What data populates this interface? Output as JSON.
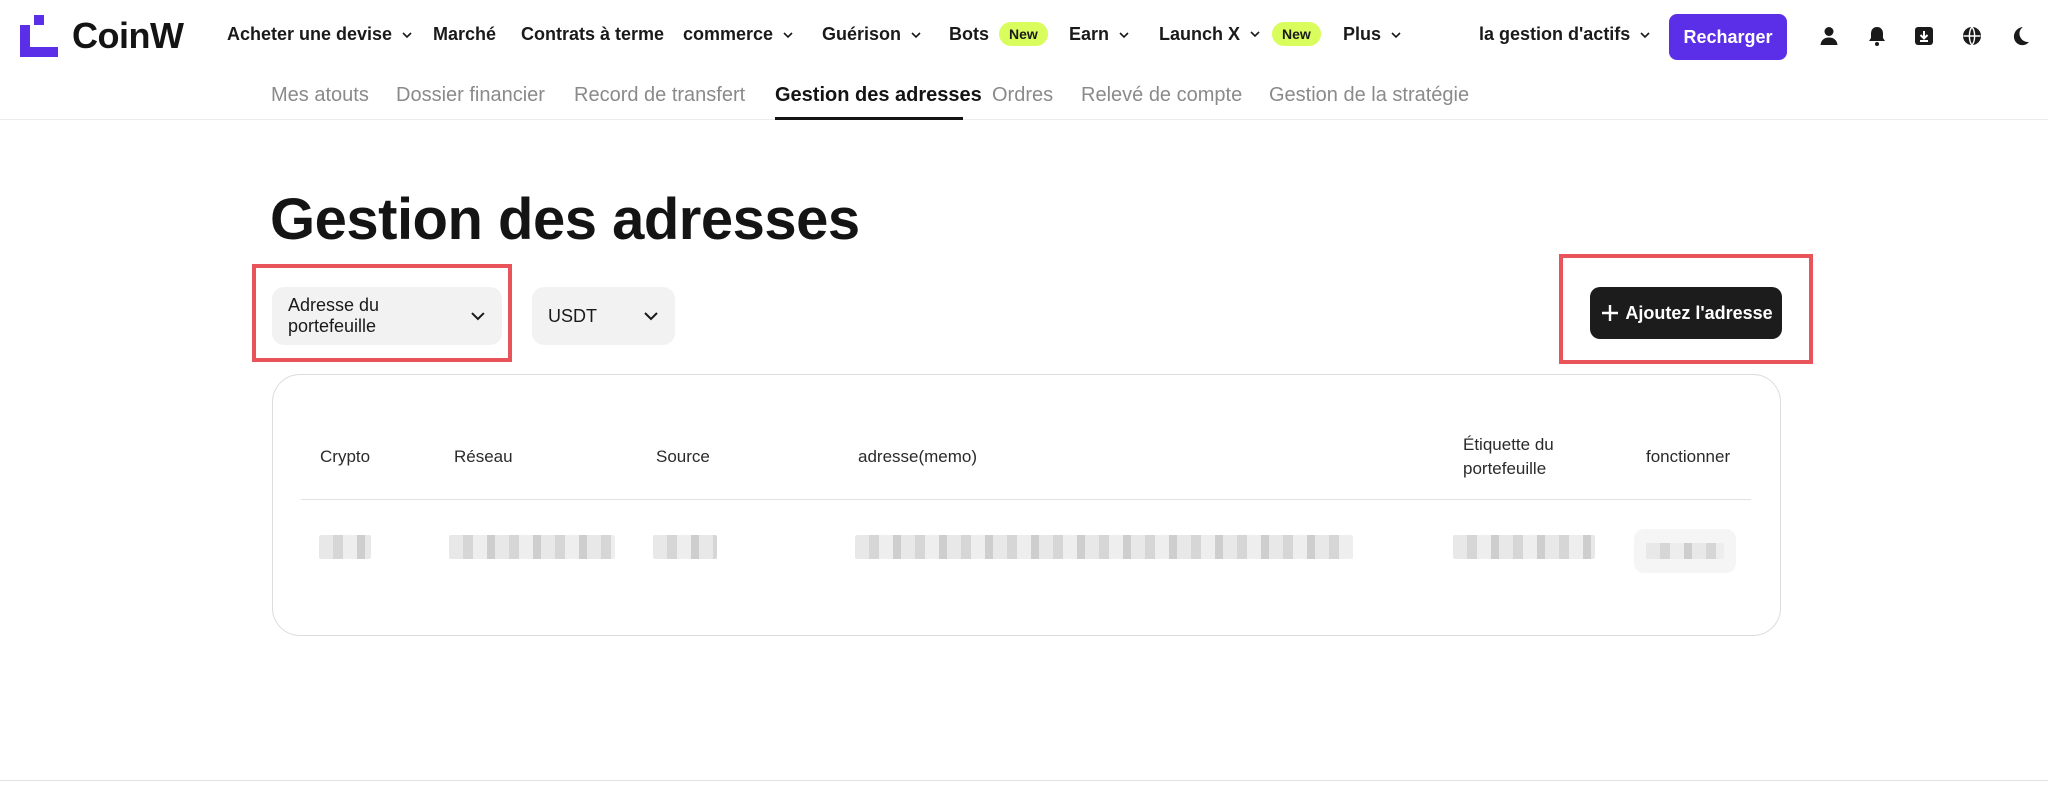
{
  "brand": {
    "name": "CoinW",
    "color": "#5b2ee8"
  },
  "nav": {
    "items": [
      {
        "label": "Acheter une devise",
        "chevron": true
      },
      {
        "label": "Marché",
        "chevron": false
      },
      {
        "label": "Contrats à terme",
        "chevron": false
      },
      {
        "label": "commerce",
        "chevron": true
      },
      {
        "label": "Guérison",
        "chevron": true
      },
      {
        "label": "Bots",
        "badge": "New"
      },
      {
        "label": "Earn",
        "chevron": true
      },
      {
        "label": "Launch X",
        "chevron": true,
        "badge": "New"
      },
      {
        "label": "Plus",
        "chevron": true
      }
    ],
    "asset_menu": "la gestion d'actifs",
    "recharge_label": "Recharger",
    "icons": [
      "user-icon",
      "bell-icon",
      "download-icon",
      "globe-icon",
      "moon-icon"
    ]
  },
  "subtabs": [
    {
      "label": "Mes atouts",
      "active": false
    },
    {
      "label": "Dossier financier",
      "active": false
    },
    {
      "label": "Record de transfert",
      "active": false
    },
    {
      "label": "Gestion des adresses",
      "active": true
    },
    {
      "label": "Ordres",
      "active": false
    },
    {
      "label": "Relevé de compte",
      "active": false
    },
    {
      "label": "Gestion de la stratégie",
      "active": false
    }
  ],
  "page": {
    "title": "Gestion des adresses",
    "filter_type": "Adresse du portefeuille",
    "filter_coin": "USDT",
    "add_button": "Ajoutez l'adresse"
  },
  "table": {
    "columns": [
      "Crypto",
      "Réseau",
      "Source",
      "adresse(memo)",
      "Étiquette du portefeuille",
      "fonctionner"
    ],
    "rows_redacted": 1
  },
  "colors": {
    "accent": "#5b2ee8",
    "badge": "#d9fd5d",
    "highlight": "#e8545a",
    "dark_button": "#1c1c1c"
  }
}
